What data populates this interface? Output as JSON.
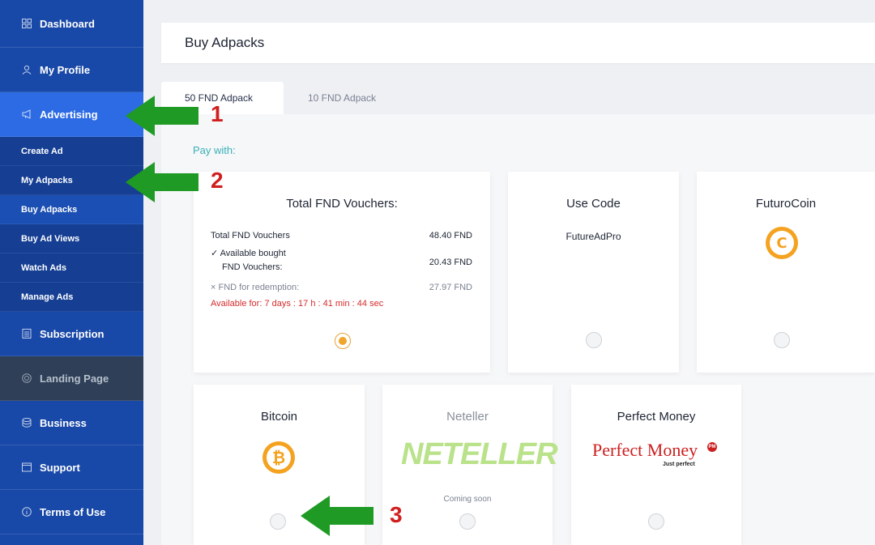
{
  "sidebar": {
    "items": [
      {
        "label": "Dashboard",
        "icon": "grid-icon"
      },
      {
        "label": "My Profile",
        "icon": "user-icon"
      },
      {
        "label": "Advertising",
        "icon": "megaphone-icon"
      },
      {
        "label": "Create Ad"
      },
      {
        "label": "My Adpacks"
      },
      {
        "label": "Buy Adpacks"
      },
      {
        "label": "Buy Ad Views"
      },
      {
        "label": "Watch Ads"
      },
      {
        "label": "Manage Ads"
      },
      {
        "label": "Subscription",
        "icon": "list-icon"
      },
      {
        "label": "Landing Page",
        "icon": "target-icon"
      },
      {
        "label": "Business",
        "icon": "database-icon"
      },
      {
        "label": "Support",
        "icon": "window-icon"
      },
      {
        "label": "Terms of Use",
        "icon": "info-icon"
      }
    ]
  },
  "header": {
    "title": "Buy Adpacks"
  },
  "tabs": [
    {
      "label": "50 FND Adpack",
      "active": true
    },
    {
      "label": "10 FND Adpack",
      "active": false
    }
  ],
  "pay_with": "Pay with:",
  "vouchers": {
    "title": "Total FND Vouchers:",
    "rows": [
      {
        "label": "Total FND Vouchers",
        "value": "48.40 FND"
      },
      {
        "label": "✓ Available bought",
        "label2": "FND Vouchers:",
        "value": "20.43 FND"
      },
      {
        "label": "× FND for redemption:",
        "value": "27.97 FND"
      }
    ],
    "available": "Available for: 7 days : 17 h : 41 min : 44 sec"
  },
  "use_code": {
    "title": "Use Code",
    "code": "FutureAdPro"
  },
  "futurocoin": {
    "title": "FuturoCoin"
  },
  "bitcoin": {
    "title": "Bitcoin"
  },
  "neteller": {
    "title": "Neteller",
    "logo": "NETELLER",
    "registered": "®",
    "status": "Coming soon"
  },
  "perfect_money": {
    "title": "Perfect Money",
    "logo": "Perfect Money",
    "badge": "PM",
    "tagline": "Just perfect"
  },
  "annotations": [
    "1",
    "2",
    "3"
  ],
  "colors": {
    "sidebar": "#1949a8",
    "active": "#2d6be4",
    "teal": "#3bb0b8",
    "radio_selected": "#f0a52c",
    "arrow": "#1f9a24",
    "number": "#d01f1f"
  }
}
